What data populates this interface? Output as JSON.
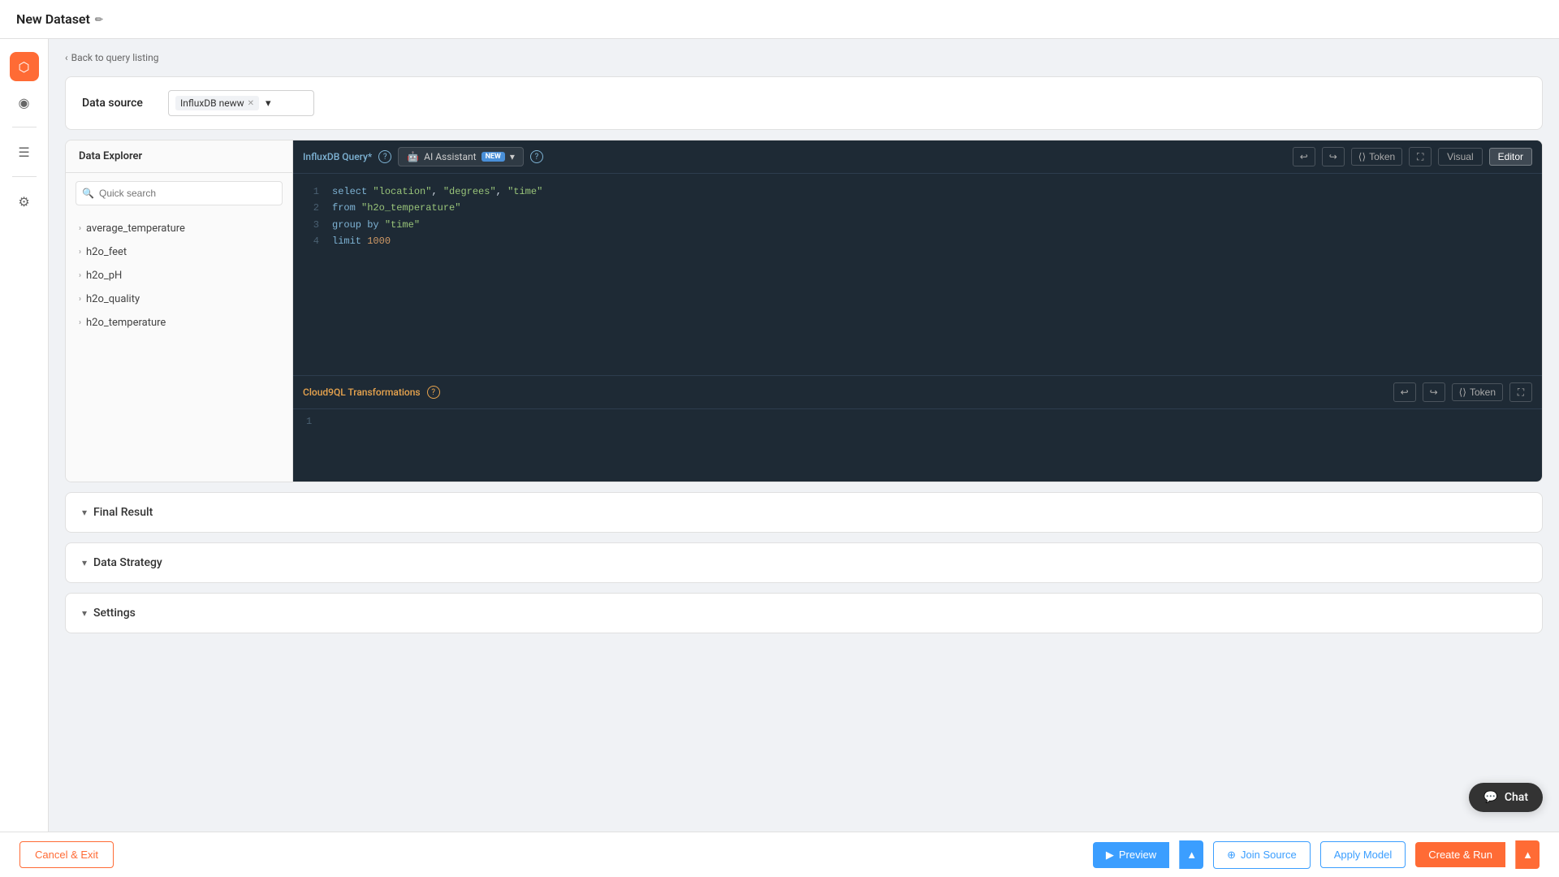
{
  "app": {
    "title": "New Dataset",
    "back_link": "Back to query listing"
  },
  "sidebar": {
    "icons": [
      {
        "name": "database-icon",
        "symbol": "⬡",
        "active": true
      },
      {
        "name": "eye-icon",
        "symbol": "◉",
        "active": false
      },
      {
        "name": "list-icon",
        "symbol": "☰",
        "active": false
      },
      {
        "name": "gear-icon",
        "symbol": "⚙",
        "active": false
      }
    ]
  },
  "data_source": {
    "label": "Data source",
    "selected": "InfluxDB neww",
    "dropdown_arrow": "▾"
  },
  "data_explorer": {
    "title": "Data Explorer",
    "search_placeholder": "Quick search",
    "items": [
      {
        "label": "average_temperature"
      },
      {
        "label": "h2o_feet"
      },
      {
        "label": "h2o_pH"
      },
      {
        "label": "h2o_quality"
      },
      {
        "label": "h2o_temperature"
      }
    ]
  },
  "influx_query": {
    "label": "InfluxDB Query*",
    "ai_label": "AI Assistant",
    "ai_badge": "NEW",
    "help": "?",
    "code_lines": [
      {
        "num": "1",
        "content": "select",
        "parts": [
          {
            "type": "keyword",
            "text": "select "
          },
          {
            "type": "string",
            "text": "\"location\""
          },
          {
            "type": "plain",
            "text": ", "
          },
          {
            "type": "string",
            "text": "\"degrees\""
          },
          {
            "type": "plain",
            "text": ", "
          },
          {
            "type": "string",
            "text": "\"time\""
          }
        ]
      },
      {
        "num": "2",
        "content": "from",
        "parts": [
          {
            "type": "keyword",
            "text": "from "
          },
          {
            "type": "string",
            "text": "\"h2o_temperature\""
          }
        ]
      },
      {
        "num": "3",
        "content": "group by",
        "parts": [
          {
            "type": "keyword",
            "text": "group by "
          },
          {
            "type": "string",
            "text": "\"time\""
          }
        ]
      },
      {
        "num": "4",
        "content": "limit",
        "parts": [
          {
            "type": "keyword",
            "text": "limit "
          },
          {
            "type": "number",
            "text": "1000"
          }
        ]
      }
    ],
    "view_visual": "Visual",
    "view_editor": "Editor",
    "token_label": "Token"
  },
  "cloudql": {
    "label": "Cloud9QL Transformations",
    "help": "?",
    "line_num": "1",
    "token_label": "Token"
  },
  "sections": {
    "final_result": "Final Result",
    "data_strategy": "Data Strategy",
    "settings": "Settings"
  },
  "bottom_toolbar": {
    "cancel_label": "Cancel & Exit",
    "preview_label": "Preview",
    "join_source_label": "Join Source",
    "apply_model_label": "Apply Model",
    "create_run_label": "Create & Run"
  },
  "chat": {
    "label": "Chat"
  },
  "colors": {
    "accent_orange": "#ff6b35",
    "accent_blue": "#3b9eff",
    "editor_bg": "#1e2a35",
    "keyword_color": "#7eb3d4",
    "string_color": "#98c379",
    "number_color": "#d19a66",
    "cloudql_label_color": "#e8a44e"
  }
}
